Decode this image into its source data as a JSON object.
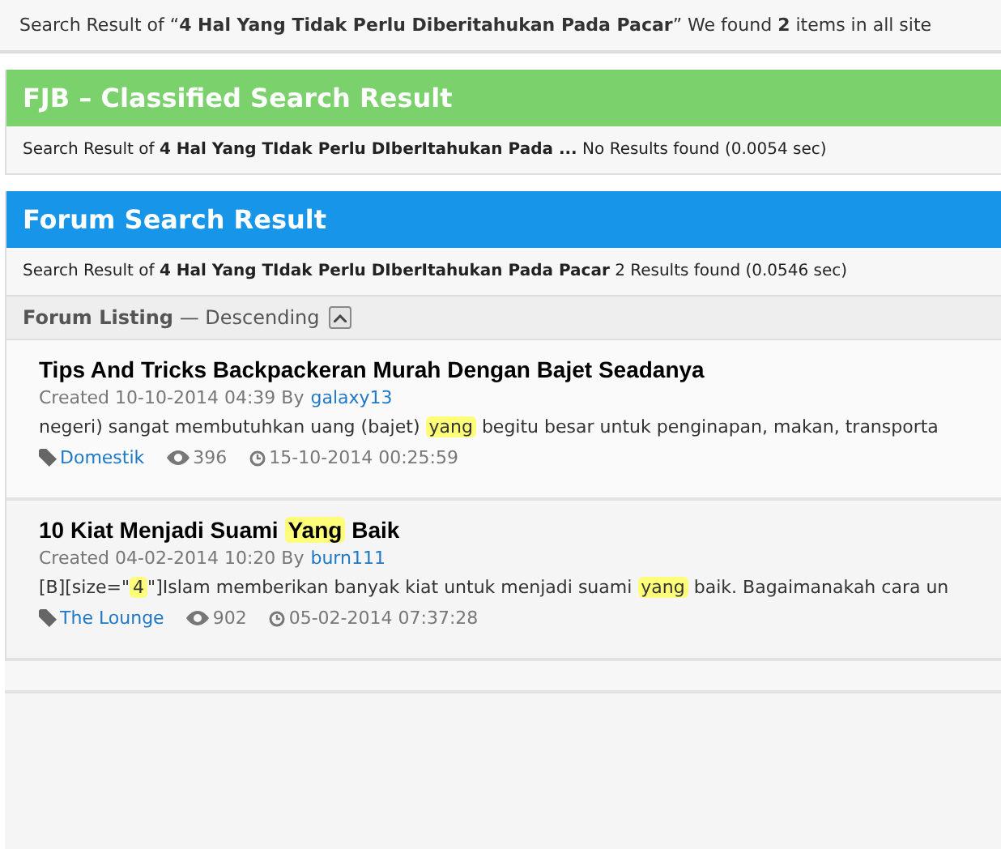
{
  "summary": "Search Result of “**4 Hal Yang Tidak Perlu Diberitahukan Pada Pacar**” We found **2** items in all site",
  "sections": [
    {
      "kind": "fjb",
      "title": "FJB – Classified Search Result",
      "info": "Search Result of **4 Hal Yang TIdak Perlu DIberItahukan Pada ...**  No Results found (0.0054 sec)"
    },
    {
      "kind": "forum",
      "title": "Forum Search Result",
      "info": "Search Result of **4 Hal Yang TIdak Perlu DIberItahukan Pada Pacar** 2 Results found (0.0546 sec)",
      "listing": {
        "label": "Forum Listing",
        "order": "— Descending",
        "expanded": true
      },
      "results": [
        {
          "title": [
            {
              "text": "Tips And Tricks Backpackeran Murah Dengan Bajet Seadanya",
              "highlight": false
            }
          ],
          "created": "Created 10-10-2014 04:39 By",
          "author": "galaxy13",
          "snippet": [
            {
              "text": "negeri) sangat membutuhkan uang (bajet) ",
              "highlight": false
            },
            {
              "text": "yang",
              "highlight": true
            },
            {
              "text": " begitu besar untuk penginapan, makan, transporta",
              "highlight": false
            }
          ],
          "category": "Domestik",
          "views": "396",
          "date": "15-10-2014 00:25:59"
        },
        {
          "title": [
            {
              "text": "10 Kiat Menjadi Suami ",
              "highlight": false
            },
            {
              "text": "Yang",
              "highlight": true
            },
            {
              "text": " Baik",
              "highlight": false
            }
          ],
          "created": "Created 04-02-2014 10:20 By",
          "author": "burn111",
          "snippet": [
            {
              "text": "[B][size=\"",
              "highlight": false
            },
            {
              "text": "4",
              "highlight": true
            },
            {
              "text": "\"]Islam memberikan banyak kiat untuk menjadi suami ",
              "highlight": false
            },
            {
              "text": "yang",
              "highlight": true
            },
            {
              "text": " baik. Bagaimanakah cara un",
              "highlight": false
            }
          ],
          "category": "The Lounge",
          "views": "902",
          "date": "05-02-2014 07:37:28"
        }
      ]
    }
  ]
}
